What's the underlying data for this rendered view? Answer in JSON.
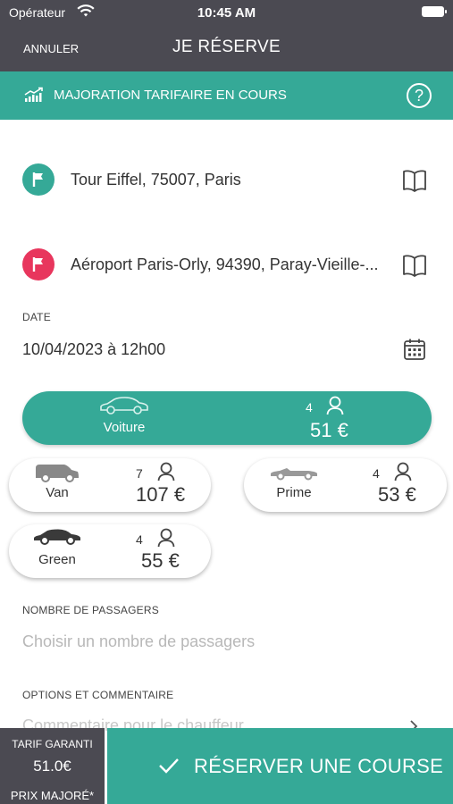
{
  "status_bar": {
    "carrier": "Opérateur",
    "time": "10:45 AM"
  },
  "header": {
    "cancel_label": "ANNULER",
    "title": "JE RÉSERVE"
  },
  "surge_banner": {
    "text": "MAJORATION TARIFAIRE EN COURS",
    "help_label": "?"
  },
  "pickup": {
    "address": "Tour Eiffel, 75007, Paris",
    "pin_color": "#35a997"
  },
  "dropoff": {
    "address": "Aéroport Paris-Orly, 94390, Paray-Vieille-...",
    "pin_color": "#e8365d"
  },
  "date": {
    "label": "DATE",
    "value": "10/04/2023 à 12h00"
  },
  "vehicles": [
    {
      "name": "Voiture",
      "seats": "4",
      "price": "51 €",
      "selected": true
    },
    {
      "name": "Van",
      "seats": "7",
      "price": "107 €",
      "selected": false
    },
    {
      "name": "Prime",
      "seats": "4",
      "price": "53 €",
      "selected": false
    },
    {
      "name": "Green",
      "seats": "4",
      "price": "55 €",
      "selected": false
    }
  ],
  "passengers": {
    "label": "NOMBRE DE PASSAGERS",
    "placeholder": "Choisir un nombre de passagers"
  },
  "options": {
    "label": "OPTIONS ET COMMENTAIRE",
    "placeholder": "Commentaire pour le chauffeur"
  },
  "footer": {
    "guaranteed_label": "TARIF GARANTI",
    "guaranteed_value": "51.0€",
    "surge_label": "PRIX MAJORÉ*",
    "book_label": "RÉSERVER UNE COURSE"
  },
  "colors": {
    "accent": "#35a997",
    "header": "#4b4a52",
    "dropoff_pin": "#e8365d"
  }
}
